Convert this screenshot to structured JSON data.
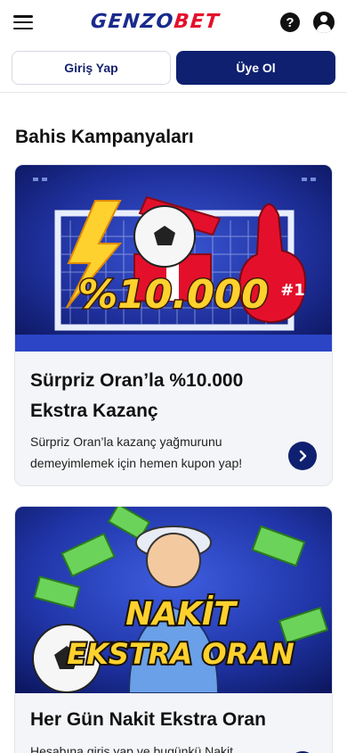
{
  "header": {
    "logo_part1": "GENZO",
    "logo_part2": "BET",
    "help_glyph": "?"
  },
  "auth": {
    "login_label": "Giriş Yap",
    "signup_label": "Üye Ol"
  },
  "page": {
    "title": "Bahis Kampanyaları"
  },
  "campaigns": [
    {
      "banner_text": "%10.000",
      "finger_text": "#1",
      "title": "Sürpriz Oran’la %10.000 Ekstra Kazanç",
      "description": "Sürpriz Oran’la kazanç yağmurunu demeyimlemek için hemen kupon yap!"
    },
    {
      "banner_line1": "NAKİT",
      "banner_line2": "EKSTRA ORAN",
      "title": "Her Gün Nakit Ekstra Oran",
      "description": "Hesabına giriş yap ve bugünkü Nakit"
    }
  ],
  "colors": {
    "brand_navy": "#0f2070",
    "brand_red": "#e4102b",
    "banner_blue": "#1e2f9a"
  }
}
